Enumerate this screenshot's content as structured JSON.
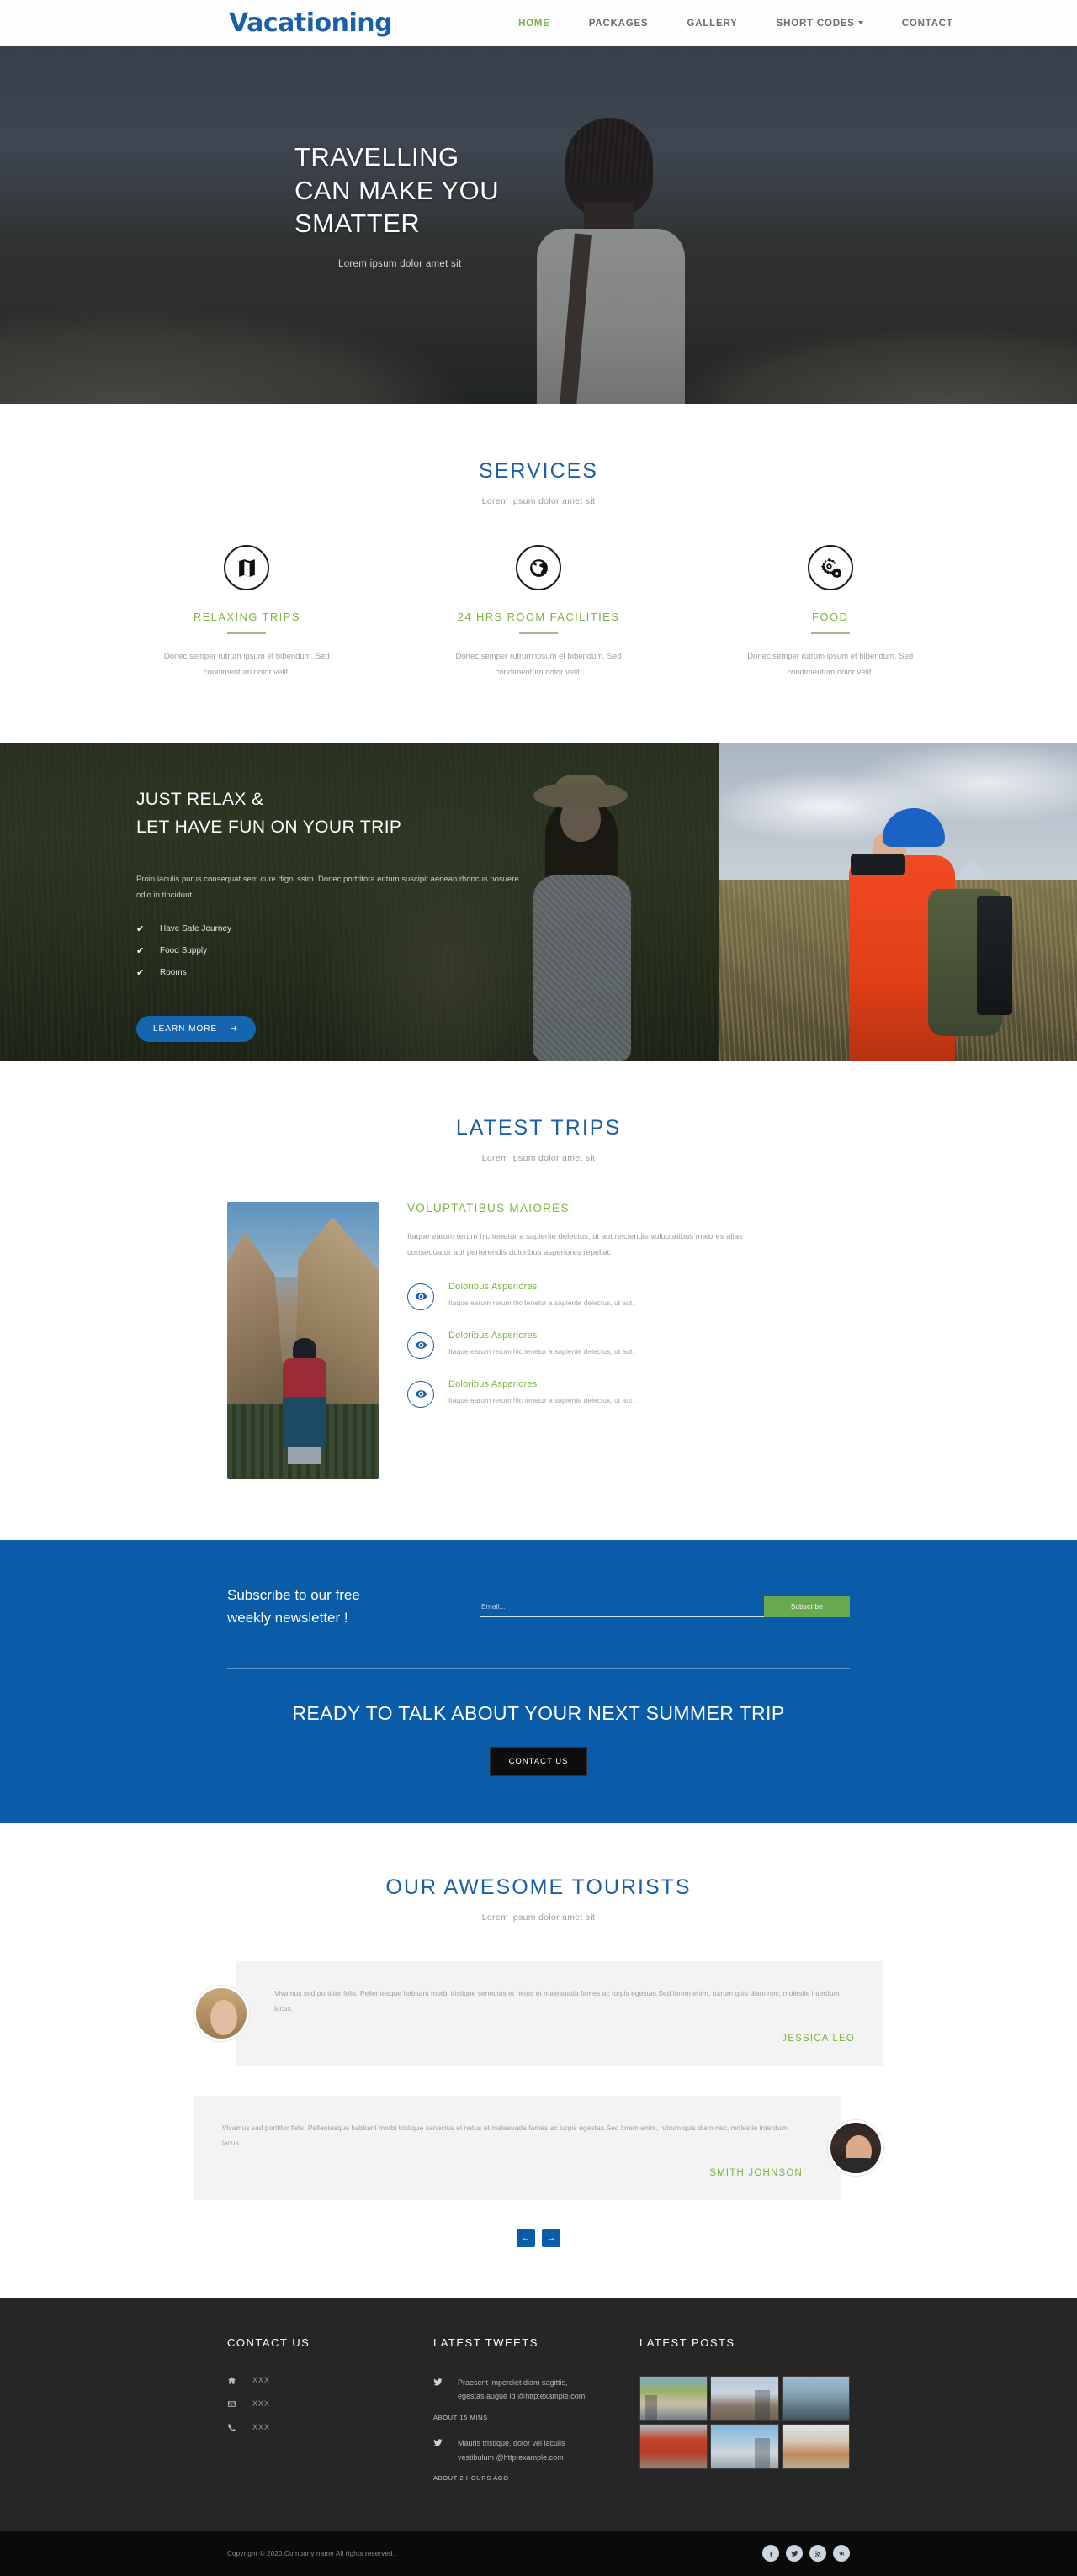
{
  "header": {
    "logo": "Vacationing",
    "nav": [
      {
        "label": "HOME",
        "active": true
      },
      {
        "label": "PACKAGES",
        "active": false
      },
      {
        "label": "GALLERY",
        "active": false
      },
      {
        "label": "SHORT CODES",
        "active": false,
        "caret": true
      },
      {
        "label": "CONTACT",
        "active": false
      }
    ]
  },
  "hero": {
    "line1": "TRAVELLING",
    "line2": "CAN MAKE YOU",
    "line3": "SMATTER",
    "subtitle": "Lorem ipsum dolor amet sit"
  },
  "services": {
    "title": "SERVICES",
    "subtitle": "Lorem ipsum dolor amet sit",
    "items": [
      {
        "icon": "map-icon",
        "name": "RELAXING TRIPS",
        "desc": "Donec semper rutrum ipsum et bibendum. Sed condimentum dolor velit."
      },
      {
        "icon": "globe-icon",
        "name": "24 HRS ROOM FACILITIES",
        "desc": "Donec semper rutrum ipsum et bibendum. Sed condimentum dolor velit."
      },
      {
        "icon": "gears-icon",
        "name": "FOOD",
        "desc": "Donec semper rutrum ipsum et bibendum. Sed condimentum dolor velit."
      }
    ]
  },
  "relax": {
    "title_line1": "JUST RELAX &",
    "title_line2": "LET HAVE FUN ON YOUR TRIP",
    "paragraph": "Proin iaculis purus consequat sem cure digni ssim. Donec porttitora entum suscipit aenean rhoncus posuere odio in tincidunt.",
    "bullets": [
      "Have Safe Journey",
      "Food Supply",
      "Rooms"
    ],
    "button": "LEARN MORE"
  },
  "trips": {
    "title": "LATEST TRIPS",
    "subtitle": "Lorem ipsum dolor amet sit",
    "heading": "VOLUPTATIBUS MAIORES",
    "paragraph": "Itaque earum rerum hic tenetur a sapiente delectus, ut aut reiciendis voluptatibus maiores alias consequatur aut perferendis doloribus asperiores repellat.",
    "items": [
      {
        "icon": "eye-icon",
        "title": "Doloribus Asperiores",
        "desc": "Itaque earum rerum hic tenetur a sapiente delectus, ut aut ."
      },
      {
        "icon": "eye-icon",
        "title": "Doloribus Asperiores",
        "desc": "Itaque earum rerum hic tenetur a sapiente delectus, ut aut ."
      },
      {
        "icon": "eye-icon",
        "title": "Doloribus Asperiores",
        "desc": "Itaque earum rerum hic tenetur a sapiente delectus, ut aut ."
      }
    ]
  },
  "cta": {
    "newsletter_line1": "Subscribe to our free",
    "newsletter_line2": "weekly newsletter !",
    "email_placeholder": "Email...",
    "email_value": "",
    "subscribe_label": "Subscribe",
    "headline": "READY TO TALK ABOUT YOUR NEXT SUMMER TRIP",
    "button": "CONTACT US",
    "bg_color": "#0a5ba8",
    "subscribe_color": "#6aa84f"
  },
  "tourists": {
    "title": "OUR AWESOME TOURISTS",
    "subtitle": "Lorem ipsum dolor amet sit",
    "reviews": [
      {
        "text": "Vivamus sed porttitor felis. Pellentesque habitant morbi tristique senectus et netus et malesuada fames ac turpis egestas.Sed lorem enim, rutrum quis diam nec, molestie interdum lacus.",
        "name": "JESSICA LEO",
        "avatar": "female-avatar"
      },
      {
        "text": "Vivamus sed porttitor felis. Pellentesque habitant morbi tristique senectus et netus et malesuada fames ac turpis egestas.Sed lorem enim, rutrum quis diam nec, molestie interdum lacus.",
        "name": "SMITH JOHNSON",
        "avatar": "male-avatar"
      }
    ],
    "prev_label": "←",
    "next_label": "→"
  },
  "footer": {
    "contact": {
      "title": "CONTACT US",
      "rows": [
        {
          "icon": "home-icon",
          "value": "XXX"
        },
        {
          "icon": "envelope-icon",
          "value": "XXX"
        },
        {
          "icon": "phone-icon",
          "value": "XXX"
        }
      ]
    },
    "tweets": {
      "title": "LATEST TWEETS",
      "items": [
        {
          "icon": "twitter-icon",
          "text": "Praesent imperdiet diam sagittis, egestas augue id @http:example.com",
          "time": "ABOUT 15 MINS"
        },
        {
          "icon": "twitter-icon",
          "text": "Mauris tristique, dolor vel iaculis vestibulum @http:example.com",
          "time": "ABOUT 2 HOURS AGO"
        }
      ]
    },
    "posts": {
      "title": "LATEST POSTS",
      "thumbs": [
        "market-thumb",
        "bridge-thumb",
        "mountain-thumb",
        "temple-thumb",
        "city-thumb",
        "beach-thumb"
      ]
    },
    "copyright": "Copyright © 2020.Company name All rights reserved.",
    "socials": [
      "facebook-icon",
      "twitter-icon",
      "rss-icon",
      "vk-icon"
    ]
  }
}
